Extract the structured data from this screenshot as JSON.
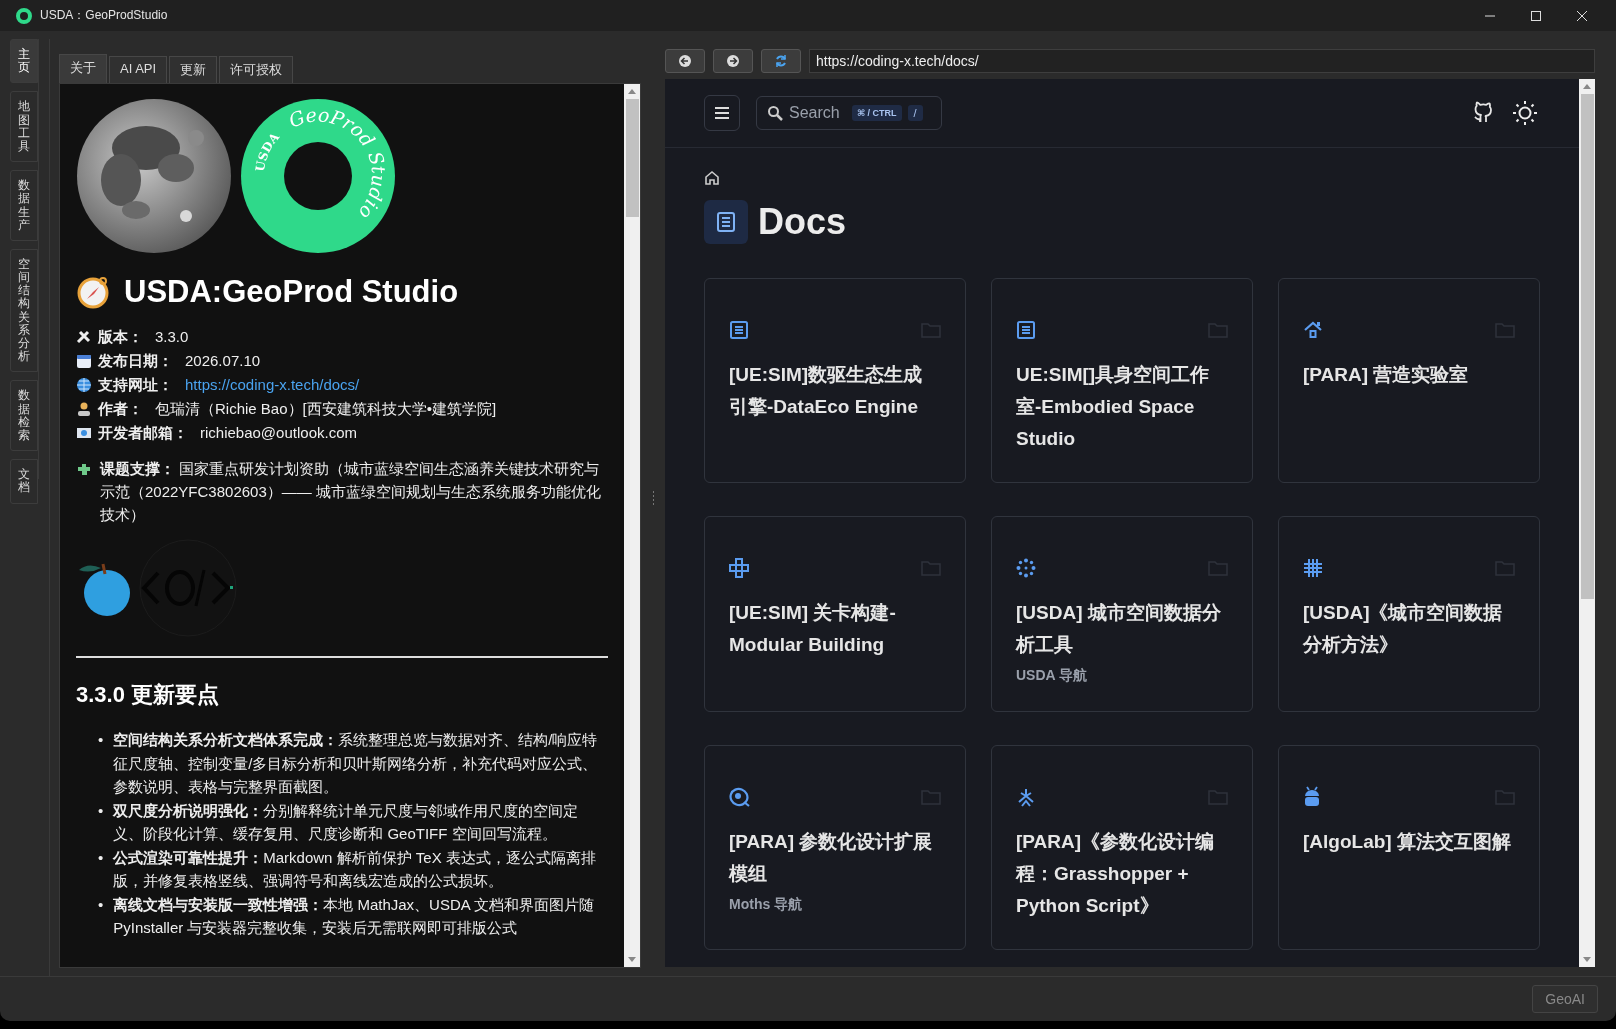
{
  "window": {
    "title": "USDA：GeoProdStudio"
  },
  "sidebar_tabs": [
    {
      "label": "主页",
      "selected": true
    },
    {
      "label": "地图工具",
      "selected": false
    },
    {
      "label": "数据生产",
      "selected": false
    },
    {
      "label": "空间结构关系分析",
      "selected": false
    },
    {
      "label": "数据检索",
      "selected": false
    },
    {
      "label": "文档",
      "selected": false
    }
  ],
  "about_tabs": [
    {
      "label": "关于",
      "selected": true
    },
    {
      "label": "AI API",
      "selected": false
    },
    {
      "label": "更新",
      "selected": false
    },
    {
      "label": "许可授权",
      "selected": false
    }
  ],
  "about": {
    "logo_ring": {
      "text_top": "GeoProd Studio",
      "text_left": "USDA"
    },
    "app_title": "USDA:GeoProd Studio",
    "info": [
      {
        "kind": "version",
        "label": "版本：",
        "value": "3.3.0"
      },
      {
        "kind": "date",
        "label": "发布日期：",
        "value": "2026.07.10"
      },
      {
        "kind": "link",
        "label": "支持网址：",
        "value": "https://coding-x.tech/docs/"
      },
      {
        "kind": "author",
        "label": "作者：",
        "value": "包瑞清（Richie Bao）[西安建筑科技大学•建筑学院]"
      },
      {
        "kind": "email",
        "label": "开发者邮箱：",
        "value": "richiebao@outlook.com"
      }
    ],
    "support": "**课题支撑：** 国家重点研发计划资助（城市蓝绿空间生态涵养关键技术研究与示范（2022YFC3802603）—— 城市蓝绿空间规划与生态系统服务功能优化技术）",
    "updates_heading": "3.3.0 更新要点",
    "updates": [
      {
        "bullet": "•",
        "text": "**空间结构关系分析文档体系完成：**系统整理总览与数据对齐、结构/响应特征尺度轴、控制变量/多目标分析和贝叶斯网络分析，补充代码对应公式、参数说明、表格与完整界面截图。"
      },
      {
        "bullet": "•",
        "text": "**双尺度分析说明强化：**分别解释统计单元尺度与邻域作用尺度的空间定义、阶段化计算、缓存复用、尺度诊断和 GeoTIFF 空间回写流程。"
      },
      {
        "bullet": "•",
        "text": "**公式渲染可靠性提升：**Markdown 解析前保护 TeX 表达式，逐公式隔离排版，并修复表格竖线、强调符号和离线宏造成的公式损坏。"
      },
      {
        "bullet": "•",
        "text": "**离线文档与安装版一致性增强：**本地 MathJax、USDA 文档和界面图片随 PyInstaller 与安装器完整收集，安装后无需联网即可排版公式"
      }
    ]
  },
  "browser": {
    "url": "https://coding-x.tech/docs/",
    "search": {
      "placeholder": "Search",
      "shortcut": "⌘ / CTRL",
      "key": "/"
    },
    "page_title": "Docs",
    "cards": [
      {
        "kind": "doc",
        "title": "[UE:SIM]数驱生态生成引擎-DataEco Engine"
      },
      {
        "kind": "doc",
        "title": "UE:SIM[]具身空间工作室-Embodied Space Studio"
      },
      {
        "kind": "house",
        "title": "[PARA] 营造实验室"
      },
      {
        "kind": "nodes",
        "title": "[UE:SIM] 关卡构建-Modular Building"
      },
      {
        "kind": "dots",
        "title": "[USDA] 城市空间数据分析工具",
        "subtitle": "USDA 导航"
      },
      {
        "kind": "hash",
        "title": "[USDA]《城市空间数据分析方法》"
      },
      {
        "kind": "ring",
        "title": "[PARA] 参数化设计扩展模组",
        "subtitle": "Moths 导航"
      },
      {
        "kind": "asterisk",
        "title": "[PARA]《参数化设计编程：Grasshopper + Python Script》"
      },
      {
        "kind": "robot",
        "title": "[AlgoLab] 算法交互图解"
      }
    ]
  },
  "status_bar": {
    "button": "GeoAI"
  }
}
